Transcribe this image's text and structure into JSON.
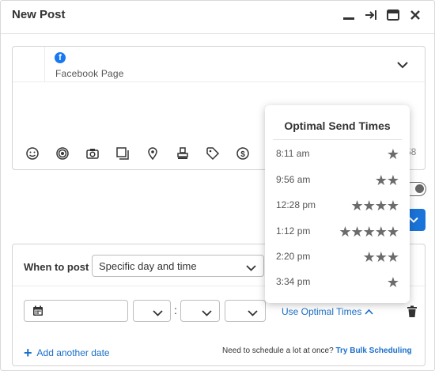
{
  "header": {
    "title": "New Post",
    "icons": [
      "minimize-icon",
      "collapse-right-icon",
      "window-icon",
      "close-icon"
    ]
  },
  "composer": {
    "network_icon": "f",
    "profile_name": "Facebook Page",
    "char_count": "58",
    "tools": [
      "emoji-icon",
      "target-icon",
      "camera-icon",
      "media-library-icon",
      "location-icon",
      "stamp-icon",
      "tag-icon",
      "dollar-icon"
    ]
  },
  "schedule": {
    "when_label": "When to post",
    "when_value": "Specific day and time",
    "date_value": "",
    "hour_value": "",
    "minute_value": "",
    "ampm_value": "",
    "optimal_link": "Use Optimal Times",
    "add_date": "Add another date",
    "bulk_prompt": "Need to schedule a lot at once?",
    "bulk_link": "Try Bulk Scheduling"
  },
  "popup": {
    "title": "Optimal Send Times",
    "times": [
      {
        "time": "8:11 am",
        "stars": 1
      },
      {
        "time": "9:56 am",
        "stars": 2
      },
      {
        "time": "12:28 pm",
        "stars": 4
      },
      {
        "time": "1:12 pm",
        "stars": 5
      },
      {
        "time": "2:20 pm",
        "stars": 3
      },
      {
        "time": "3:34 pm",
        "stars": 1
      }
    ]
  },
  "colors": {
    "accent": "#1a73d9",
    "link": "#1a6fc9",
    "facebook": "#1877f2",
    "star": "#6b6b6b"
  }
}
